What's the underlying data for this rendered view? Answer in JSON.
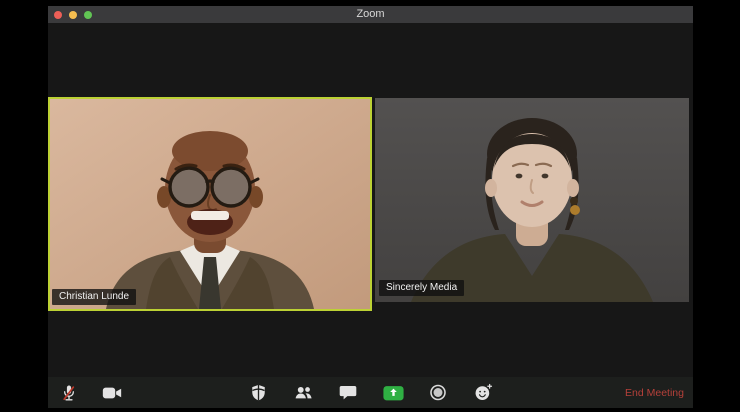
{
  "window": {
    "title": "Zoom",
    "traffic_lights": [
      {
        "name": "close"
      },
      {
        "name": "minimize"
      },
      {
        "name": "zoom-fullscreen"
      }
    ]
  },
  "participants": [
    {
      "name": "Christian Lunde",
      "active_speaker": true,
      "description": "smiling man with round glasses, tweed jacket, white shirt and tie on tan background"
    },
    {
      "name": "Sincerely Media",
      "active_speaker": false,
      "description": "woman with short dark hair, olive v-neck top, amber earring on dark gray background"
    }
  ],
  "toolbar": {
    "buttons": [
      {
        "id": "mute",
        "icon": "microphone-muted-icon",
        "state": "muted"
      },
      {
        "id": "video",
        "icon": "video-camera-icon",
        "state": "on"
      },
      {
        "id": "security",
        "icon": "shield-icon"
      },
      {
        "id": "participants",
        "icon": "participants-icon"
      },
      {
        "id": "chat",
        "icon": "chat-bubble-icon"
      },
      {
        "id": "share-screen",
        "icon": "share-screen-icon"
      },
      {
        "id": "record",
        "icon": "record-icon"
      },
      {
        "id": "reactions",
        "icon": "reactions-smiley-icon"
      }
    ],
    "end_meeting_label": "End Meeting"
  },
  "colors": {
    "active_speaker_border": "#bcd134",
    "share_screen_green": "#2fb043",
    "end_meeting_red": "#b5403a",
    "mute_slash_red": "#c0392b",
    "titlebar_bg": "#3a3a3c",
    "content_bg": "#171717",
    "toolbar_bg": "#1d1f1d"
  }
}
